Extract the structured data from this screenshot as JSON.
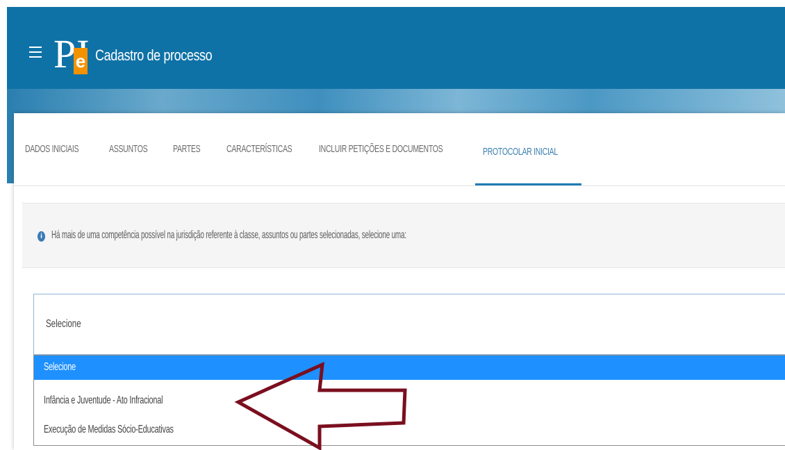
{
  "header": {
    "menu_icon": "hamburger-icon",
    "logo_text": "PJ",
    "logo_e": "e",
    "title": "Cadastro de processo"
  },
  "tabs": [
    {
      "label": "DADOS INICIAIS",
      "active": false
    },
    {
      "label": "ASSUNTOS",
      "active": false
    },
    {
      "label": "PARTES",
      "active": false
    },
    {
      "label": "CARACTERÍSTICAS",
      "active": false
    },
    {
      "label": "INCLUIR PETIÇÕES E DOCUMENTOS",
      "active": false
    },
    {
      "label": "PROTOCOLAR INICIAL",
      "active": true
    }
  ],
  "info": {
    "icon": "info-icon",
    "message": "Há mais de uma competência possível na jurisdição referente à classe, assuntos ou partes selecionadas, selecione uma:"
  },
  "select": {
    "value": "Selecione",
    "options": [
      "Selecione",
      "Infância e Juventude - Ato Infracional",
      "Execução de Medidas Sócio-Educativas"
    ],
    "highlighted_index": 0
  },
  "colors": {
    "header": "#0f72a6",
    "accent": "#1f7ab3",
    "logo_orange": "#f39200",
    "option_highlight": "#1e90ff",
    "annotation_arrow": "#7a0f1f"
  }
}
